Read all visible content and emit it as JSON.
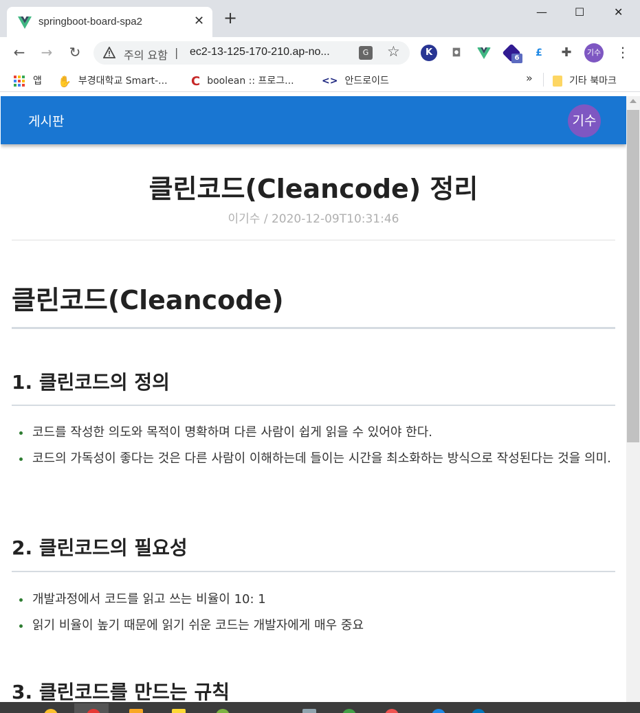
{
  "browser": {
    "tab_title": "springboot-board-spa2",
    "tab_close": "✕",
    "new_tab": "+",
    "security_label": "주의 요함",
    "url": "ec2-13-125-170-210.ap-no...",
    "profile_initials": "기수",
    "extension_badge": "6",
    "window_controls": {
      "minimize": "—",
      "maximize": "☐",
      "close": "✕"
    }
  },
  "bookmarks": {
    "apps": "앱",
    "items": [
      {
        "label": "부경대학교 Smart-...",
        "icon": "hand-logo-icon"
      },
      {
        "label": "boolean :: 프로그...",
        "icon": "c-logo-icon"
      },
      {
        "label": "안드로이드",
        "icon": "android-icon"
      }
    ],
    "more": "»",
    "other_bookmarks": "기타 북마크"
  },
  "app": {
    "title": "게시판",
    "avatar": "기수"
  },
  "post": {
    "title": "클린코드(Cleancode) 정리",
    "meta": "이기수 / 2020-12-09T10:31:46",
    "h1": "클린코드(Cleancode)",
    "sections": [
      {
        "heading": "1. 클린코드의 정의",
        "bullets": [
          "코드를 작성한 의도와 목적이 명확하며 다른 사람이 쉽게 읽을 수 있어야 한다.",
          "코드의 가독성이 좋다는 것은 다른 사람이 이해하는데 들이는 시간을 최소화하는 방식으로 작성된다는 것을 의미."
        ]
      },
      {
        "heading": "2. 클린코드의 필요성",
        "bullets": [
          "개발과정에서 코드를 읽고 쓰는 비율이 10: 1",
          "읽기 비율이 높기 때문에 읽기 쉬운 코드는 개발자에게 매우 중요"
        ]
      },
      {
        "heading": "3. 클린코드를 만드는 규칙",
        "bullets": []
      }
    ]
  },
  "colors": {
    "appbar": "#1976d2",
    "avatar": "#7e57c2",
    "bullet": "#2e7d32",
    "meta_text": "#b0b0b0",
    "rule": "#d5dbe1"
  }
}
